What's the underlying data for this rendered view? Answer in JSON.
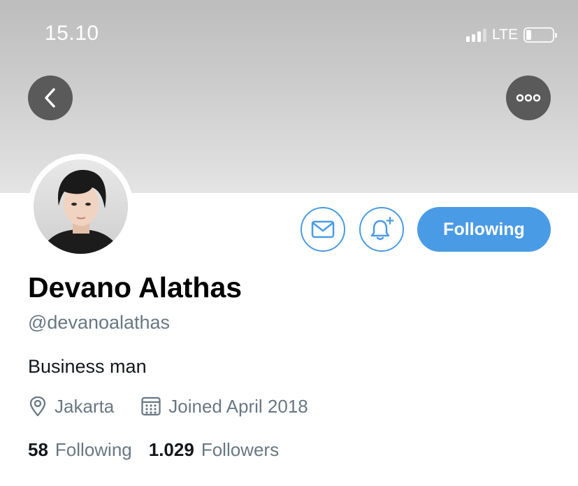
{
  "status_bar": {
    "time": "15.10",
    "network": "LTE",
    "battery_level": 0.15
  },
  "header": {
    "back_icon": "chevron-left-icon",
    "more_icon": "ellipsis-icon"
  },
  "profile": {
    "display_name": "Devano Alathas",
    "handle": "@devanoalathas",
    "bio": "Business man",
    "location": "Jakarta",
    "joined": "Joined April 2018",
    "following_count": "58",
    "following_label": "Following",
    "followers_count": "1.029",
    "followers_label": "Followers"
  },
  "actions": {
    "message_icon": "envelope-icon",
    "notify_icon": "bell-plus-icon",
    "follow_button_label": "Following"
  },
  "colors": {
    "accent": "#4a9be6",
    "secondary_text": "#687882",
    "primary_text": "#14171a",
    "nav_button_bg": "#5a5a5a"
  }
}
